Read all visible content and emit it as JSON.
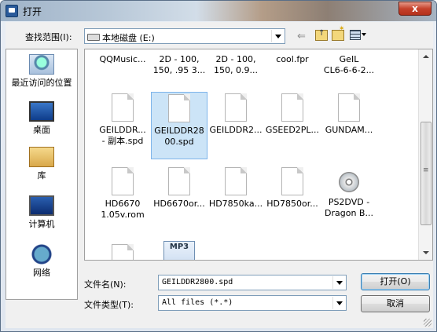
{
  "window": {
    "title": "打开",
    "close_label": "x"
  },
  "lookin": {
    "label": "查找范围(I):",
    "value": "本地磁盘 (E:)"
  },
  "places": [
    {
      "label": "最近访问的位置",
      "icon": "recent-places-icon"
    },
    {
      "label": "桌面",
      "icon": "desktop-icon"
    },
    {
      "label": "库",
      "icon": "library-icon"
    },
    {
      "label": "计算机",
      "icon": "computer-icon"
    },
    {
      "label": "网络",
      "icon": "network-icon"
    }
  ],
  "files": {
    "row0": [
      {
        "line1": "QQMusic...",
        "line2": ""
      },
      {
        "line1": "2D - 100,",
        "line2": "150, .95 3..."
      },
      {
        "line1": "2D - 100,",
        "line2": "150, 0.9..."
      },
      {
        "line1": "cool.fpr",
        "line2": ""
      },
      {
        "line1": "GeIL",
        "line2": "CL6-6-6-2..."
      }
    ],
    "row1": [
      {
        "line1": "GEILDDR...",
        "line2": "- 副本.spd"
      },
      {
        "line1": "GEILDDR28",
        "line2": "00.spd"
      },
      {
        "line1": "GEILDDR2...",
        "line2": ""
      },
      {
        "line1": "GSEED2PL...",
        "line2": ""
      },
      {
        "line1": "GUNDAM...",
        "line2": ""
      }
    ],
    "row2": [
      {
        "line1": "HD6670",
        "line2": "1.05v.rom"
      },
      {
        "line1": "HD6670or...",
        "line2": ""
      },
      {
        "line1": "HD7850ka...",
        "line2": ""
      },
      {
        "line1": "HD7850or...",
        "line2": ""
      },
      {
        "line1": "PS2DVD -",
        "line2": "Dragon B..."
      }
    ],
    "mp3_label": "MP3"
  },
  "filename": {
    "label": "文件名(N):",
    "value": "GEILDDR2800.spd"
  },
  "filetype": {
    "label": "文件类型(T):",
    "value": "All files (*.*)"
  },
  "buttons": {
    "open": "打开(O)",
    "cancel": "取消"
  },
  "colors": {
    "selection": "#cce4f7",
    "selection_border": "#7eb4ea",
    "close": "#c6422c"
  }
}
